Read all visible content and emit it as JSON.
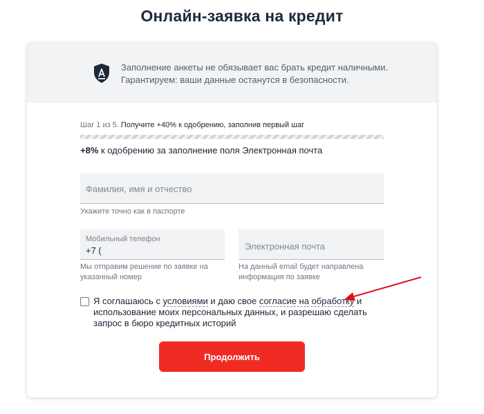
{
  "page": {
    "title": "Онлайн-заявка на кредит"
  },
  "notice": {
    "icon": "shield-letter-a-icon",
    "line1": "Заполнение анкеты не обязывает вас брать кредит наличными.",
    "line2": "Гарантируем: ваши данные останутся в безопасности."
  },
  "step": {
    "counter": "Шаг 1 из 5.",
    "text": "Получите +40% к одобрению, заполнив первый шаг",
    "progress_fraction": 1.0
  },
  "bonus": {
    "bold": "+8%",
    "text": "к одобрению за заполнение поля Электронная почта"
  },
  "fields": {
    "full_name": {
      "placeholder": "Фамилия, имя и отчество",
      "hint": "Укажите точно как в паспорте"
    },
    "phone": {
      "label": "Мобильный телефон",
      "value": "+7 (",
      "hint_line1": "Мы отправим решение по заявке на",
      "hint_line2": "указанный номер"
    },
    "email": {
      "placeholder": "Электронная почта",
      "hint_line1": "На данный email будет направлена",
      "hint_line2": "информация по заявке"
    }
  },
  "consent": {
    "checked": false,
    "prefix": "Я соглашаюсь с ",
    "link1": "условиями",
    "middle": " и даю свое ",
    "link2": "согласие на обработку",
    "rest": " и использование моих персональных данных, и разрешаю сделать запрос в бюро кредитных историй"
  },
  "submit": {
    "label": "Продолжить"
  },
  "colors": {
    "accent": "#ef2b24",
    "title": "#1d2a3a",
    "notice_bg": "#f2f3f5",
    "field_bg": "#f1f2f4",
    "annotation_arrow": "#e0101f"
  }
}
